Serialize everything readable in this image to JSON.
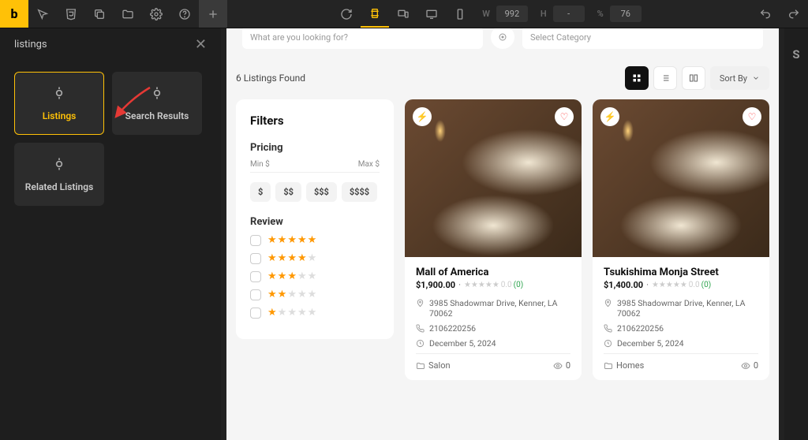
{
  "topbar": {
    "logo": "b",
    "width_label": "W",
    "width_value": "992",
    "height_label": "H",
    "height_value": "-",
    "zoom_label": "%",
    "zoom_value": "76"
  },
  "sidebar": {
    "title": "listings",
    "cards": [
      {
        "label": "Listings",
        "selected": true
      },
      {
        "label": "Search Results",
        "selected": false
      },
      {
        "label": "Related Listings",
        "selected": false
      }
    ]
  },
  "page": {
    "search_placeholder": "What are you looking for?",
    "category_placeholder": "Select Category",
    "results_text": "6 Listings Found",
    "sort_label": "Sort By",
    "filters": {
      "title": "Filters",
      "pricing_label": "Pricing",
      "min_label": "Min $",
      "max_label": "Max $",
      "chips": [
        "$",
        "$$",
        "$$$",
        "$$$$"
      ],
      "review_label": "Review",
      "stars": [
        5,
        4,
        3,
        2,
        1
      ]
    },
    "listings": [
      {
        "title": "Mall of America",
        "price": "$1,900.00",
        "rating": "0.0",
        "rating_count": "(0)",
        "address": "3985 Shadowmar Drive, Kenner, LA 70062",
        "phone": "2106220256",
        "date": "December 5, 2024",
        "category": "Salon",
        "views": "0"
      },
      {
        "title": "Tsukishima Monja Street",
        "price": "$1,400.00",
        "rating": "0.0",
        "rating_count": "(0)",
        "address": "3985 Shadowmar Drive, Kenner, LA 70062",
        "phone": "2106220256",
        "date": "December 5, 2024",
        "category": "Homes",
        "views": "0"
      }
    ]
  },
  "rightpanel": {
    "label": "S"
  }
}
